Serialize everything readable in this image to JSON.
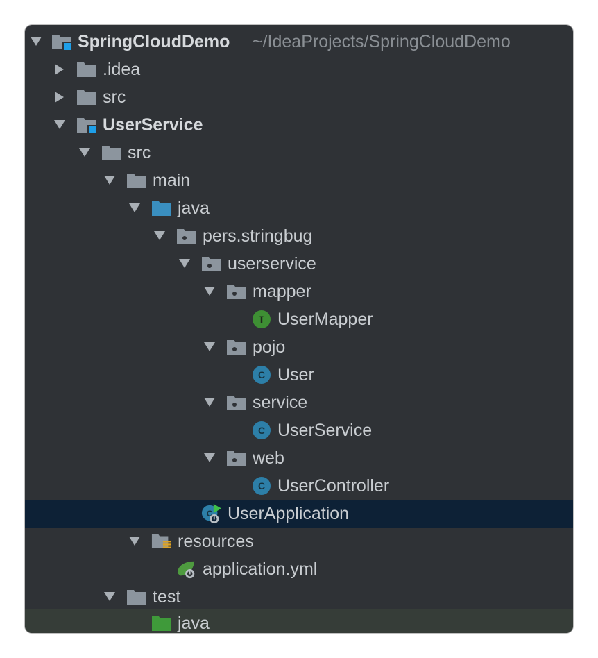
{
  "project": {
    "name": "SpringCloudDemo",
    "path": "~/IdeaProjects/SpringCloudDemo"
  },
  "tree": {
    "idea": ".idea",
    "root_src": "src",
    "module": "UserService",
    "module_src": "src",
    "main": "main",
    "java": "java",
    "package_root": "pers.stringbug",
    "userservice_pkg": "userservice",
    "mapper_pkg": "mapper",
    "user_mapper": "UserMapper",
    "pojo_pkg": "pojo",
    "user_class": "User",
    "service_pkg": "service",
    "user_service_class": "UserService",
    "web_pkg": "web",
    "user_controller": "UserController",
    "user_application": "UserApplication",
    "resources": "resources",
    "application_yml": "application.yml",
    "test": "test",
    "test_java": "java"
  },
  "colors": {
    "background": "#2f3236",
    "selection": "#0d2136",
    "folder": "#8c959e",
    "source_folder": "#3a8fc0",
    "test_folder": "#3f9a3a",
    "class_icon": "#2d7fa8",
    "interface_icon": "#3e8f34",
    "module_badge": "#1e9fe8"
  }
}
